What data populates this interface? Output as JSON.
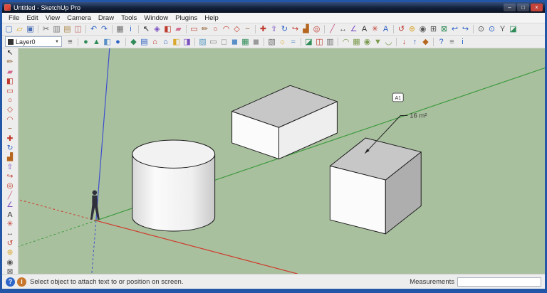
{
  "colors": {
    "win_border": "#2456a8",
    "canvas_bg": "#a9c09f",
    "edge": "#1d1d1d",
    "axis_red": "#cf3a2a",
    "axis_green": "#3d9a3d",
    "axis_blue": "#3d50cc",
    "face_top": "#c7c7c7",
    "face_front": "#fbfbfb",
    "face_side_light": "#eeeeee",
    "face_side_dark": "#aeaeae",
    "cyl_top": "#f2f2f2",
    "figure": "#30303c",
    "label_text": "#3a3a3a"
  },
  "window": {
    "title": "Untitled - SketchUp Pro",
    "minimize": "–",
    "maximize": "□",
    "close": "×"
  },
  "menu": {
    "items": [
      "File",
      "Edit",
      "View",
      "Camera",
      "Draw",
      "Tools",
      "Window",
      "Plugins",
      "Help"
    ]
  },
  "toolbar_row1": {
    "icons": [
      {
        "name": "new",
        "glyph": "▢",
        "color": "#4a78c8"
      },
      {
        "name": "open",
        "glyph": "▱",
        "color": "#d9a72e"
      },
      {
        "name": "save",
        "glyph": "▣",
        "color": "#4a6fb5"
      },
      {
        "sep": true
      },
      {
        "name": "cut",
        "glyph": "✂",
        "color": "#5a5a5a"
      },
      {
        "name": "copy",
        "glyph": "▥",
        "color": "#7a7a7a"
      },
      {
        "name": "paste",
        "glyph": "▤",
        "color": "#ad8a4f"
      },
      {
        "name": "erase-selected",
        "glyph": "◫",
        "color": "#c06a6a"
      },
      {
        "sep": true
      },
      {
        "name": "undo",
        "glyph": "↶",
        "color": "#2f62c4"
      },
      {
        "name": "redo",
        "glyph": "↷",
        "color": "#2f62c4"
      },
      {
        "sep": true
      },
      {
        "name": "print",
        "glyph": "▦",
        "color": "#6d6d6d"
      },
      {
        "name": "model-info",
        "glyph": "i",
        "color": "#2e66c9"
      },
      {
        "sep": true
      },
      {
        "name": "select",
        "glyph": "↖",
        "color": "#1c1c1c"
      },
      {
        "name": "make-component",
        "glyph": "◈",
        "color": "#7a4fc0"
      },
      {
        "name": "paint-bucket",
        "glyph": "◧",
        "color": "#bf3a2e"
      },
      {
        "name": "eraser",
        "glyph": "▰",
        "color": "#d0708c"
      },
      {
        "sep": true
      },
      {
        "name": "rectangle",
        "glyph": "▭",
        "color": "#bf3a2e"
      },
      {
        "name": "line",
        "glyph": "✏",
        "color": "#8a5a2a"
      },
      {
        "name": "circle",
        "glyph": "○",
        "color": "#bf3a2e"
      },
      {
        "name": "arc",
        "glyph": "◠",
        "color": "#bf3a2e"
      },
      {
        "name": "polygon",
        "glyph": "◇",
        "color": "#bf3a2e"
      },
      {
        "name": "freehand",
        "glyph": "~",
        "color": "#8a5a2a"
      },
      {
        "sep": true
      },
      {
        "name": "move",
        "glyph": "✚",
        "color": "#bf3a2e"
      },
      {
        "name": "push-pull",
        "glyph": "⇧",
        "color": "#7a4fc0"
      },
      {
        "name": "rotate",
        "glyph": "↻",
        "color": "#2f62c4"
      },
      {
        "name": "follow-me",
        "glyph": "↪",
        "color": "#bf3a2e"
      },
      {
        "name": "scale",
        "glyph": "▟",
        "color": "#b5651d"
      },
      {
        "name": "offset",
        "glyph": "◎",
        "color": "#bf3a2e"
      },
      {
        "sep": true
      },
      {
        "name": "tape-measure",
        "glyph": "╱",
        "color": "#c55a8a"
      },
      {
        "name": "dimension",
        "glyph": "↔",
        "color": "#555555"
      },
      {
        "name": "protractor",
        "glyph": "∠",
        "color": "#7a4fc0"
      },
      {
        "name": "text",
        "glyph": "A",
        "color": "#333333"
      },
      {
        "name": "axes",
        "glyph": "✳",
        "color": "#bf3a2e"
      },
      {
        "name": "3d-text",
        "glyph": "A",
        "color": "#2f62c4"
      },
      {
        "sep": true
      },
      {
        "name": "orbit",
        "glyph": "↺",
        "color": "#bf3a2e"
      },
      {
        "name": "pan",
        "glyph": "⊕",
        "color": "#d9a72e"
      },
      {
        "name": "zoom",
        "glyph": "◉",
        "color": "#555555"
      },
      {
        "name": "zoom-window",
        "glyph": "⊞",
        "color": "#555555"
      },
      {
        "name": "zoom-extents",
        "glyph": "⊠",
        "color": "#2e8b57"
      },
      {
        "name": "previous-view",
        "glyph": "↩",
        "color": "#2f62c4"
      },
      {
        "name": "next-view",
        "glyph": "↪",
        "color": "#2f62c4"
      },
      {
        "sep": true
      },
      {
        "name": "position-camera",
        "glyph": "⊙",
        "color": "#555555"
      },
      {
        "name": "look-around",
        "glyph": "⊙",
        "color": "#2f62c4"
      },
      {
        "name": "walk",
        "glyph": "Y",
        "color": "#555555"
      },
      {
        "name": "section-plane",
        "glyph": "◪",
        "color": "#2e8b57"
      }
    ]
  },
  "toolbar_row2": {
    "layer": {
      "value": "Layer0",
      "arrow": "▼"
    },
    "icons": [
      {
        "name": "layer-manager",
        "glyph": "≡",
        "color": "#555555"
      },
      {
        "sep": true
      },
      {
        "name": "add-location",
        "glyph": "●",
        "color": "#2e8b57"
      },
      {
        "name": "toggle-terrain",
        "glyph": "▲",
        "color": "#2e8b57"
      },
      {
        "name": "photo-textures",
        "glyph": "◧",
        "color": "#5a8fc8"
      },
      {
        "name": "preview-in-google-earth",
        "glyph": "●",
        "color": "#2f62c4"
      },
      {
        "sep": true
      },
      {
        "name": "view-iso",
        "glyph": "◆",
        "color": "#2e8b57"
      },
      {
        "name": "view-top",
        "glyph": "▤",
        "color": "#2f62c4"
      },
      {
        "name": "view-front",
        "glyph": "⌂",
        "color": "#bf3a2e"
      },
      {
        "name": "view-back",
        "glyph": "⌂",
        "color": "#2f62c4"
      },
      {
        "name": "view-left",
        "glyph": "◧",
        "color": "#d9a72e"
      },
      {
        "name": "view-right",
        "glyph": "◨",
        "color": "#7a4fc0"
      },
      {
        "sep": true
      },
      {
        "name": "style-xray",
        "glyph": "▨",
        "color": "#5a9ac0"
      },
      {
        "name": "style-wireframe",
        "glyph": "▭",
        "color": "#777777"
      },
      {
        "name": "style-hidden-line",
        "glyph": "◻",
        "color": "#999999"
      },
      {
        "name": "style-shaded",
        "glyph": "◼",
        "color": "#5a8fc8"
      },
      {
        "name": "style-shaded-textures",
        "glyph": "▦",
        "color": "#2e8b57"
      },
      {
        "name": "style-monochrome",
        "glyph": "◼",
        "color": "#9a9a9a"
      },
      {
        "sep": true
      },
      {
        "name": "shadows-dialog",
        "glyph": "▧",
        "color": "#6d6d6d"
      },
      {
        "name": "shadows-toggle",
        "glyph": "☼",
        "color": "#d9a72e"
      },
      {
        "name": "fog",
        "glyph": "≈",
        "color": "#5a8fc8"
      },
      {
        "sep": true
      },
      {
        "name": "section-plane-tool",
        "glyph": "◪",
        "color": "#2e8b57"
      },
      {
        "name": "display-section-planes",
        "glyph": "◫",
        "color": "#bf3a2e"
      },
      {
        "name": "display-section-cuts",
        "glyph": "▥",
        "color": "#6d6d6d"
      },
      {
        "sep": true
      },
      {
        "name": "sandbox-from-contours",
        "glyph": "◠",
        "color": "#7d9b4e"
      },
      {
        "name": "sandbox-from-scratch",
        "glyph": "▦",
        "color": "#7d9b4e"
      },
      {
        "name": "smoove",
        "glyph": "◉",
        "color": "#7d9b4e"
      },
      {
        "name": "stamp",
        "glyph": "▼",
        "color": "#7d9b4e"
      },
      {
        "name": "drape",
        "glyph": "◡",
        "color": "#7d9b4e"
      },
      {
        "sep": true
      },
      {
        "name": "get-models",
        "glyph": "↓",
        "color": "#bf3a2e"
      },
      {
        "name": "share-model",
        "glyph": "↑",
        "color": "#2f62c4"
      },
      {
        "name": "extension-warehouse",
        "glyph": "◆",
        "color": "#b5651d"
      },
      {
        "sep": true
      },
      {
        "name": "instructor",
        "glyph": "?",
        "color": "#2f62c4"
      },
      {
        "name": "outliner",
        "glyph": "≡",
        "color": "#777777"
      },
      {
        "name": "entity-info",
        "glyph": "i",
        "color": "#2e66c9"
      }
    ]
  },
  "tool_palette": {
    "icons": [
      {
        "name": "select",
        "glyph": "↖",
        "color": "#111111"
      },
      {
        "name": "line",
        "glyph": "✏",
        "color": "#8a5a2a"
      },
      {
        "name": "eraser",
        "glyph": "▰",
        "color": "#d06a8c"
      },
      {
        "name": "paint-bucket",
        "glyph": "◧",
        "color": "#bf3a2e"
      },
      {
        "name": "rectangle",
        "glyph": "▭",
        "color": "#bf3a2e"
      },
      {
        "name": "circle",
        "glyph": "○",
        "color": "#bf3a2e"
      },
      {
        "name": "polygon",
        "glyph": "◇",
        "color": "#bf3a2e"
      },
      {
        "name": "arc",
        "glyph": "◠",
        "color": "#bf3a2e"
      },
      {
        "name": "freehand",
        "glyph": "~",
        "color": "#8a5a2a"
      },
      {
        "name": "move",
        "glyph": "✚",
        "color": "#bf3a2e"
      },
      {
        "name": "rotate",
        "glyph": "↻",
        "color": "#2f62c4"
      },
      {
        "name": "scale",
        "glyph": "▟",
        "color": "#b5651d"
      },
      {
        "name": "push-pull",
        "glyph": "⇧",
        "color": "#7a4fc0"
      },
      {
        "name": "follow-me",
        "glyph": "↪",
        "color": "#bf3a2e"
      },
      {
        "name": "offset",
        "glyph": "◎",
        "color": "#bf3a2e"
      },
      {
        "name": "tape-measure",
        "glyph": "╱",
        "color": "#d06a8c"
      },
      {
        "name": "protractor",
        "glyph": "∠",
        "color": "#7a4fc0"
      },
      {
        "name": "text",
        "glyph": "A",
        "color": "#333333"
      },
      {
        "name": "axes",
        "glyph": "✳",
        "color": "#bf3a2e"
      },
      {
        "name": "dimension",
        "glyph": "↔",
        "color": "#555555"
      },
      {
        "name": "orbit",
        "glyph": "↺",
        "color": "#bf3a2e"
      },
      {
        "name": "pan",
        "glyph": "⊕",
        "color": "#d9a72e"
      },
      {
        "name": "zoom",
        "glyph": "◉",
        "color": "#555555"
      },
      {
        "name": "zoom-extents",
        "glyph": "⊠",
        "color": "#555555"
      }
    ]
  },
  "canvas": {
    "area_label": "16 m²",
    "cursor_badge": "A1"
  },
  "statusbar": {
    "icons": [
      {
        "name": "help",
        "glyph": "?",
        "color": "#ffffff",
        "bg": "#2e66c9"
      },
      {
        "name": "geolocation-info",
        "glyph": "i",
        "color": "#ffffff",
        "bg": "#c8762c"
      }
    ],
    "message": "Select object to attach text to or position on screen.",
    "measurements_label": "Measurements",
    "measurements_value": ""
  }
}
